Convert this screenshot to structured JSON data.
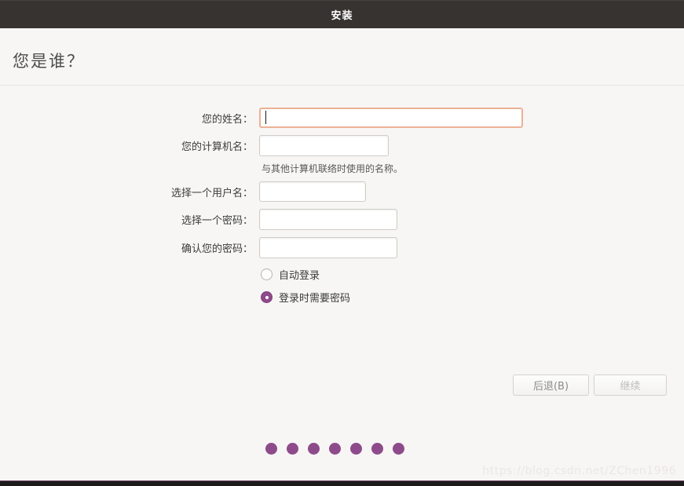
{
  "window": {
    "titlebar": {
      "title": "安装"
    }
  },
  "page": {
    "title": "您是谁？"
  },
  "form": {
    "fields": [
      {
        "id": "fullname",
        "label": "您的姓名：",
        "value": "",
        "focused": true
      },
      {
        "id": "hostname",
        "label": "您的计算机名：",
        "value": "",
        "hint": "与其他计算机联络时使用的名称。"
      },
      {
        "id": "username",
        "label": "选择一个用户名：",
        "value": ""
      },
      {
        "id": "password",
        "label": "选择一个密码：",
        "value": ""
      },
      {
        "id": "confirm-password",
        "label": "确认您的密码：",
        "value": ""
      }
    ],
    "radios": [
      {
        "id": "auto-login",
        "label": "自动登录",
        "selected": false
      },
      {
        "id": "require-password",
        "label": "登录时需要密码",
        "selected": true
      }
    ]
  },
  "buttons": {
    "back": "后退(B)",
    "continue": "继续"
  },
  "progress": {
    "dot_count": 7,
    "dot_color": "#8e4b8b"
  },
  "watermark": "https://blog.csdn.net/ZChen1996",
  "colors": {
    "titlebar_bg": "#373330",
    "body_bg": "#f7f6f5",
    "focus_border": "#ecb195",
    "aubergine": "#8e4b8b"
  }
}
